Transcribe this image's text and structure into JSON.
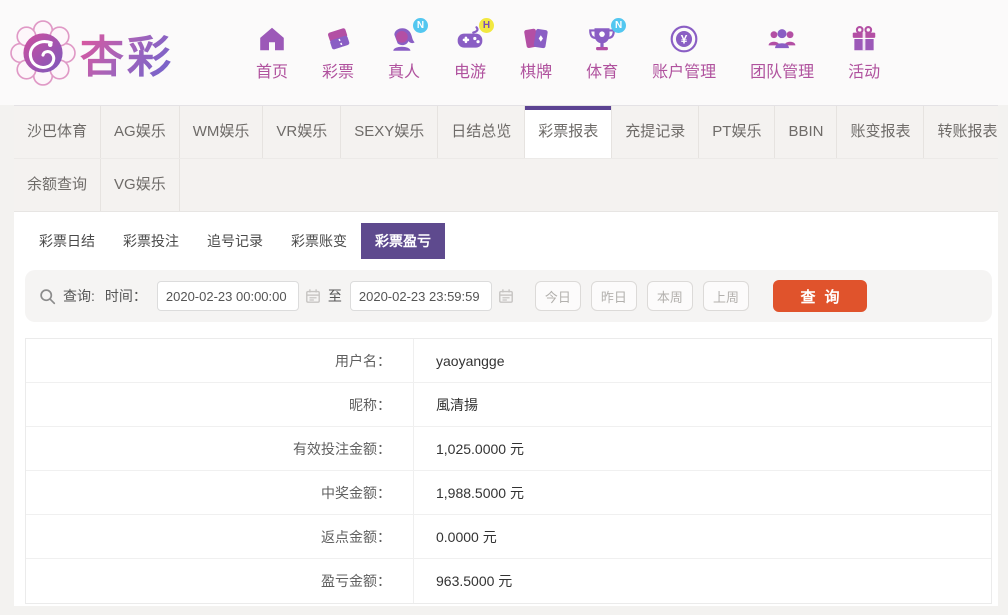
{
  "brand": {
    "name": "杏彩"
  },
  "header": {
    "nav": [
      {
        "label": "首页",
        "icon": "home-icon",
        "badge": ""
      },
      {
        "label": "彩票",
        "icon": "tickets-icon",
        "badge": ""
      },
      {
        "label": "真人",
        "icon": "live-person-icon",
        "badge": "N"
      },
      {
        "label": "电游",
        "icon": "gamepad-icon",
        "badge": "H"
      },
      {
        "label": "棋牌",
        "icon": "cards-icon",
        "badge": ""
      },
      {
        "label": "体育",
        "icon": "trophy-icon",
        "badge": "N"
      },
      {
        "label": "账户管理",
        "icon": "coin-icon",
        "badge": ""
      },
      {
        "label": "团队管理",
        "icon": "team-icon",
        "badge": ""
      },
      {
        "label": "活动",
        "icon": "gift-icon",
        "badge": ""
      }
    ]
  },
  "tabs": {
    "row1": [
      "沙巴体育",
      "AG娱乐",
      "WM娱乐",
      "VR娱乐",
      "SEXY娱乐",
      "日结总览",
      "彩票报表",
      "充提记录",
      "PT娱乐",
      "BBIN",
      "账变报表",
      "转账报表"
    ],
    "row2": [
      "余额查询",
      "VG娱乐"
    ],
    "active": "彩票报表"
  },
  "subtabs": {
    "items": [
      "彩票日结",
      "彩票投注",
      "追号记录",
      "彩票账变",
      "彩票盈亏"
    ],
    "active": "彩票盈亏"
  },
  "search": {
    "query_label": "查询:",
    "time_label": "时间：",
    "from": "2020-02-23 00:00:00",
    "to": "2020-02-23 23:59:59",
    "range_separator": "至",
    "quick": [
      "今日",
      "昨日",
      "本周",
      "上周"
    ],
    "submit": "查询"
  },
  "table": {
    "rows": [
      {
        "label": "用户名：",
        "value": "yaoyangge"
      },
      {
        "label": "昵称：",
        "value": "風清揚"
      },
      {
        "label": "有效投注金额：",
        "value": "1,025.0000 元"
      },
      {
        "label": "中奖金额：",
        "value": "1,988.5000 元"
      },
      {
        "label": "返点金额：",
        "value": "0.0000 元"
      },
      {
        "label": "盈亏金额：",
        "value": "963.5000 元"
      }
    ]
  },
  "colors": {
    "accent_purple": "#5c4392",
    "subtab_purple": "#5e4a8e",
    "nav_text": "#b0529e",
    "icon_purple": "#8a5ec4",
    "icon_magenta": "#b34fa4",
    "submit_orange": "#e0532c",
    "badge_blue": "#53c7f0",
    "badge_yellow": "#f2e840"
  }
}
